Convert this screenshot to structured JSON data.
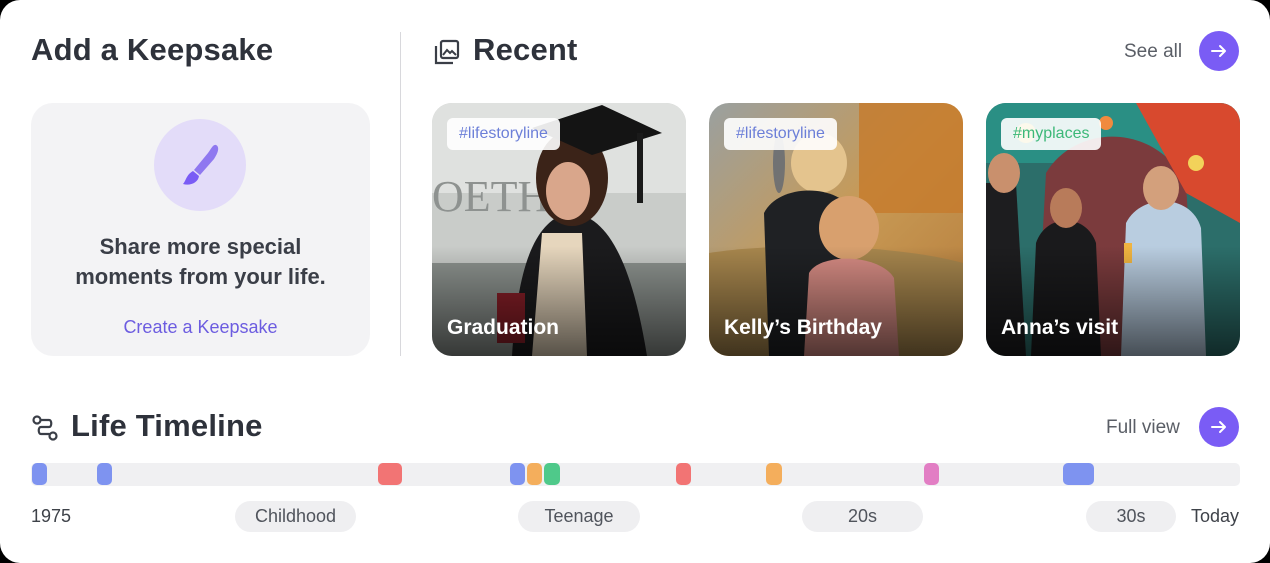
{
  "keepsake": {
    "title": "Add a Keepsake",
    "line1": "Share more special",
    "line2": "moments from your life.",
    "link": "Create a Keepsake"
  },
  "recent": {
    "title": "Recent",
    "see_all": "See all",
    "cards": [
      {
        "tag": "#lifestoryline",
        "caption": "Graduation",
        "tag_color": "#6c7fd8"
      },
      {
        "tag": "#lifestoryline",
        "caption": "Kelly’s Birthday",
        "tag_color": "#6c7fd8"
      },
      {
        "tag": "#myplaces",
        "caption": "Anna’s visit",
        "tag_color": "#3cb878"
      }
    ]
  },
  "timeline": {
    "title": "Life Timeline",
    "full_view": "Full view",
    "start": "1975",
    "end": "Today",
    "eras": [
      "Childhood",
      "Teenage",
      "20s",
      "30s"
    ]
  },
  "colors": {
    "accent": "#7a5cf5",
    "blue": "#7e93f0",
    "red": "#f27474",
    "orange": "#f4ae5c",
    "green": "#4fc98a",
    "pink": "#e27ec4"
  }
}
